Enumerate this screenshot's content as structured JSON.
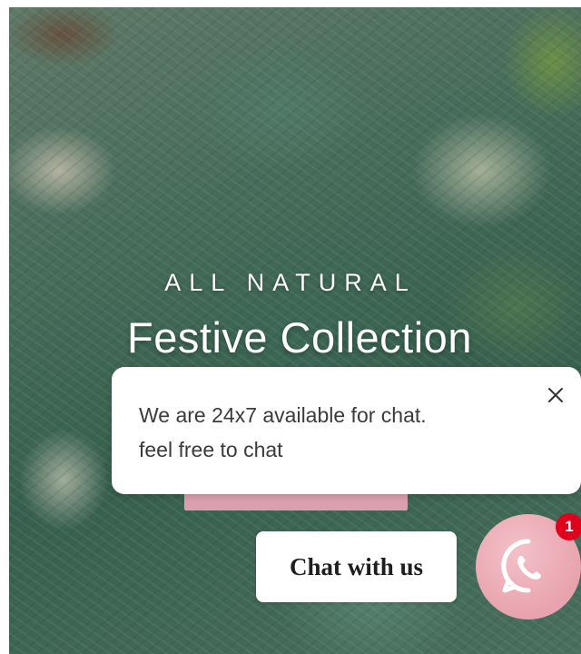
{
  "hero": {
    "eyebrow": "ALL NATURAL",
    "title": "Festive Collection"
  },
  "chat_popup": {
    "line1": "We are 24x7 available for chat.",
    "line2": "feel free to chat",
    "close_icon": "close-icon"
  },
  "chat_cta": {
    "label": "Chat with us"
  },
  "whatsapp": {
    "icon": "whatsapp-icon",
    "badge_count": "1",
    "button_color": "#e8a3ae",
    "badge_color": "#e0001b"
  }
}
